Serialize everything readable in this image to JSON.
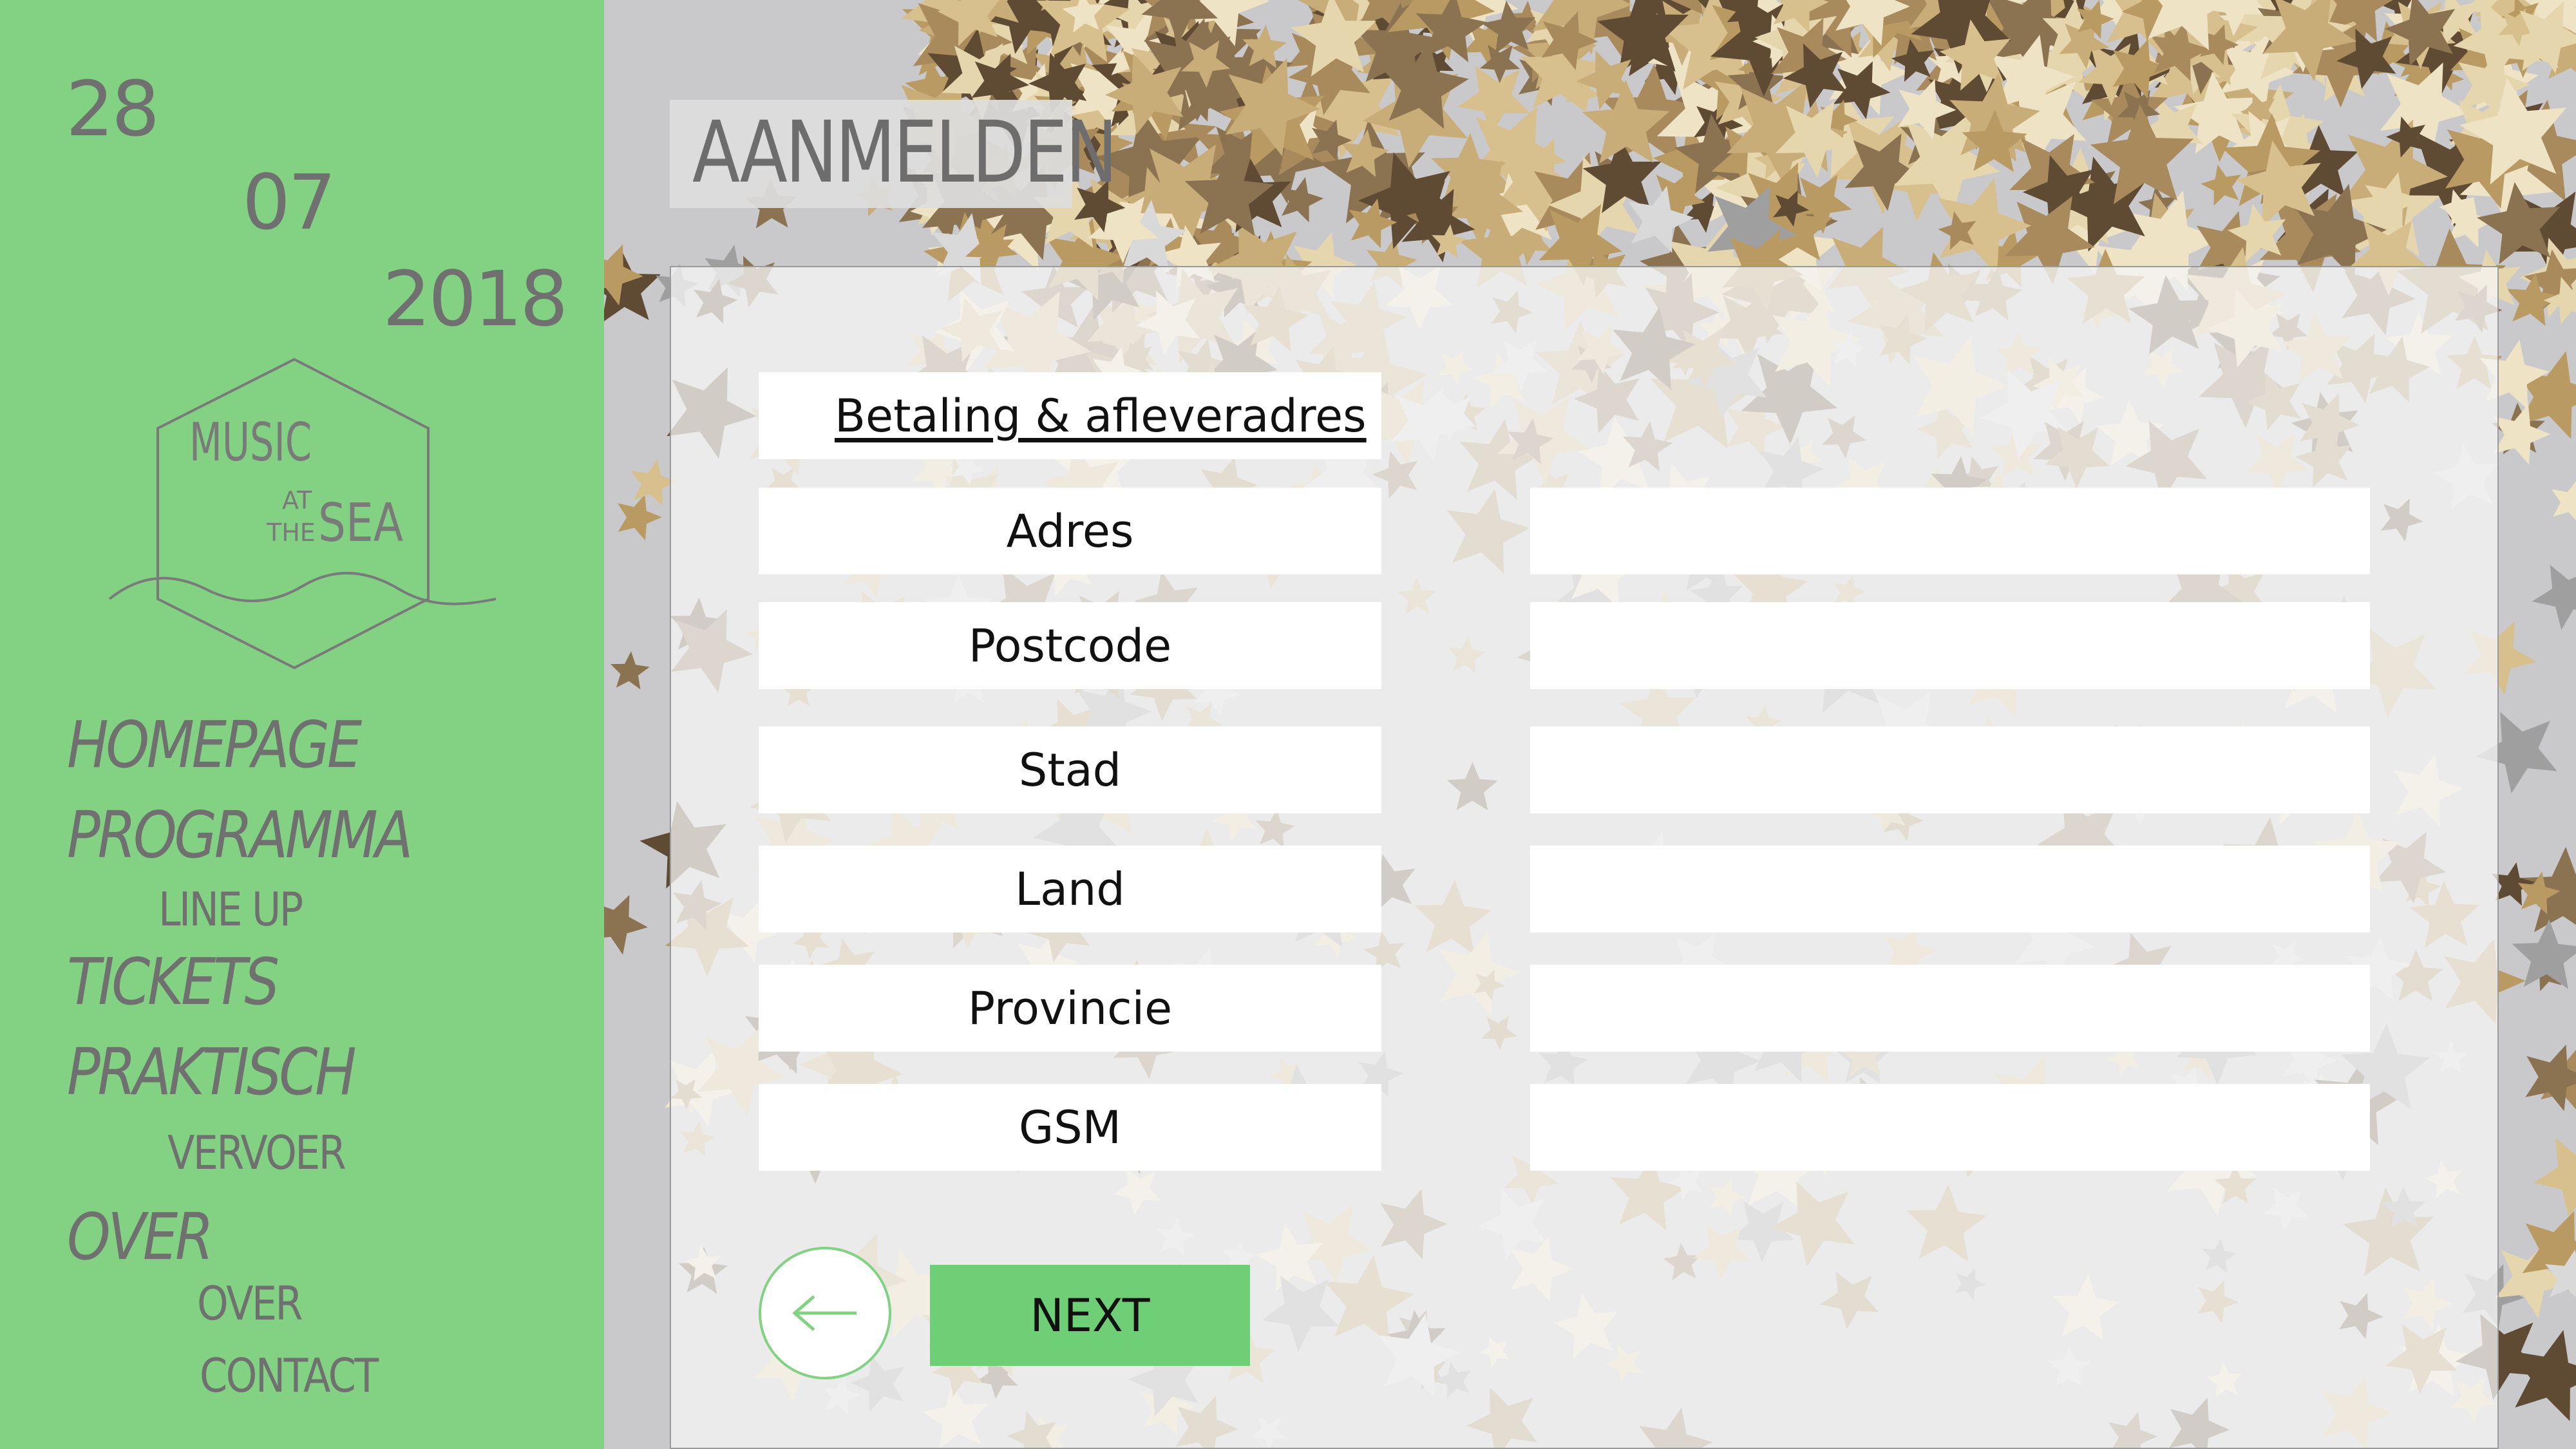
{
  "sidebar": {
    "date": {
      "day": "28",
      "month": "07",
      "year": "2018"
    },
    "logo": {
      "line1": "MUSIC",
      "line2": "AT",
      "line3": "THE",
      "line4": "SEA"
    },
    "nav": {
      "homepage": "HOMEPAGE",
      "programma": "PROGRAMMA",
      "lineup": "LINE UP",
      "tickets": "TICKETS",
      "praktisch": "PRAKTISCH",
      "vervoer": "VERVOER",
      "over": "OVER",
      "over_sub": "OVER",
      "contact": "CONTACT"
    }
  },
  "page": {
    "title": "AANMELDEN"
  },
  "form": {
    "section_label": "Betaling & afleveradres",
    "fields": [
      {
        "label": "Adres",
        "value": ""
      },
      {
        "label": "Postcode",
        "value": ""
      },
      {
        "label": "Stad",
        "value": ""
      },
      {
        "label": "Land",
        "value": ""
      },
      {
        "label": "Provincie",
        "value": ""
      },
      {
        "label": "GSM",
        "value": ""
      }
    ],
    "next_label": "NEXT"
  },
  "colors": {
    "accent": "#83d283",
    "text_gray": "#707070",
    "button": "#6fcf77"
  },
  "icons": {
    "back": "arrow-left-icon"
  }
}
